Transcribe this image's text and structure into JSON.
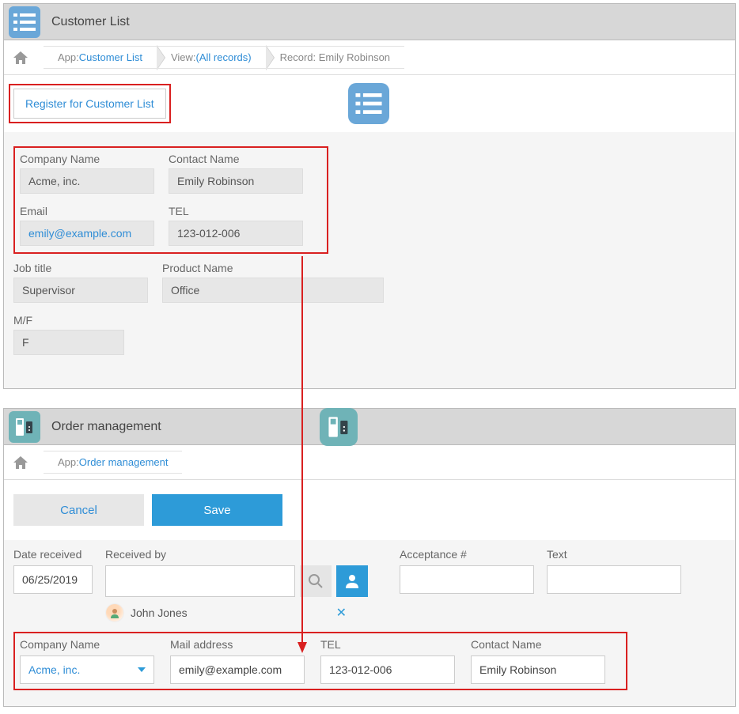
{
  "top": {
    "title": "Customer List",
    "breadcrumb": {
      "app_label": "App: ",
      "app_link": "Customer List",
      "view_label": "View: ",
      "view_link": "(All records)",
      "record_label": "Record: Emily Robinson"
    },
    "register_button": "Register for Customer List",
    "fields": {
      "company_name_label": "Company Name",
      "company_name_value": "Acme, inc.",
      "contact_name_label": "Contact Name",
      "contact_name_value": "Emily Robinson",
      "email_label": "Email",
      "email_value": "emily@example.com",
      "tel_label": "TEL",
      "tel_value": "123-012-006",
      "job_title_label": "Job title",
      "job_title_value": "Supervisor",
      "product_name_label": "Product Name",
      "product_name_value": "Office",
      "mf_label": "M/F",
      "mf_value": "F"
    }
  },
  "bottom": {
    "title": "Order management",
    "breadcrumb": {
      "app_label": "App: ",
      "app_link": "Order management"
    },
    "cancel_button": "Cancel",
    "save_button": "Save",
    "form": {
      "date_label": "Date received",
      "date_value": "06/25/2019",
      "received_by_label": "Received by",
      "received_by_user": "John Jones",
      "acceptance_label": "Acceptance #",
      "text_label": "Text",
      "company_label": "Company Name",
      "company_value": "Acme, inc.",
      "mail_label": "Mail address",
      "mail_value": "emily@example.com",
      "tel_label": "TEL",
      "tel_value": "123-012-006",
      "contact_label": "Contact Name",
      "contact_value": "Emily Robinson"
    }
  }
}
